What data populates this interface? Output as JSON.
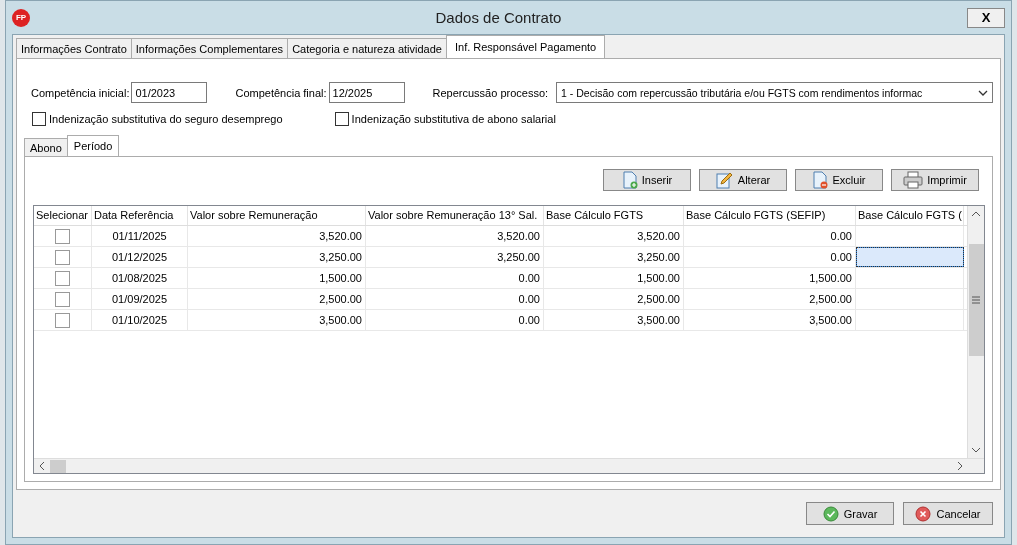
{
  "window": {
    "title": "Dados de Contrato",
    "logo": "FP",
    "close": "X"
  },
  "tabs": [
    {
      "label": "Informações Contrato",
      "selected": false
    },
    {
      "label": "Informações Complementares",
      "selected": false
    },
    {
      "label": "Categoria e natureza atividade",
      "selected": false
    },
    {
      "label": "Inf. Responsável Pagamento",
      "selected": true
    }
  ],
  "fields": [
    {
      "label": "Competência inicial:",
      "value": "01/2023"
    },
    {
      "label": "Competência final:",
      "value": "12/2025"
    }
  ],
  "repercussao": {
    "label": "Repercussão processo:",
    "value": "1 - Decisão com repercussão tributária e/ou FGTS com rendimentos informac"
  },
  "checkboxes": [
    {
      "label": "Indenização substitutiva do seguro desemprego",
      "checked": false
    },
    {
      "label": "Indenização substitutiva de abono salarial",
      "checked": false
    }
  ],
  "subtabs": [
    {
      "label": "Abono",
      "selected": false
    },
    {
      "label": "Período",
      "selected": true
    }
  ],
  "toolbar": [
    {
      "label": "Inserir",
      "kind": "insert"
    },
    {
      "label": "Alterar",
      "kind": "edit"
    },
    {
      "label": "Excluir",
      "kind": "delete"
    },
    {
      "label": "Imprimir",
      "kind": "print"
    }
  ],
  "table": {
    "columns": [
      "Selecionar",
      "Data Referência",
      "Valor sobre Remuneração",
      "Valor sobre Remuneração 13° Sal.",
      "Base Cálculo FGTS",
      "Base Cálculo FGTS (SEFIP)",
      "Base Cálculo FGTS ("
    ],
    "rows": [
      {
        "checked": false,
        "selected": false,
        "cells": [
          "",
          "01/11/2025",
          "3,520.00",
          "3,520.00",
          "3,520.00",
          "0.00"
        ]
      },
      {
        "checked": false,
        "selected": true,
        "cells": [
          "",
          "01/12/2025",
          "3,250.00",
          "3,250.00",
          "3,250.00",
          "0.00"
        ]
      },
      {
        "checked": false,
        "selected": false,
        "cells": [
          "",
          "01/08/2025",
          "1,500.00",
          "0.00",
          "1,500.00",
          "1,500.00"
        ]
      },
      {
        "checked": false,
        "selected": false,
        "cells": [
          "",
          "01/09/2025",
          "2,500.00",
          "0.00",
          "2,500.00",
          "2,500.00"
        ]
      },
      {
        "checked": false,
        "selected": false,
        "cells": [
          "",
          "01/10/2025",
          "3,500.00",
          "0.00",
          "3,500.00",
          "3,500.00"
        ]
      }
    ]
  },
  "buttons": [
    {
      "label": "Gravar",
      "kind": "save"
    },
    {
      "label": "Cancelar",
      "kind": "cancel"
    }
  ]
}
